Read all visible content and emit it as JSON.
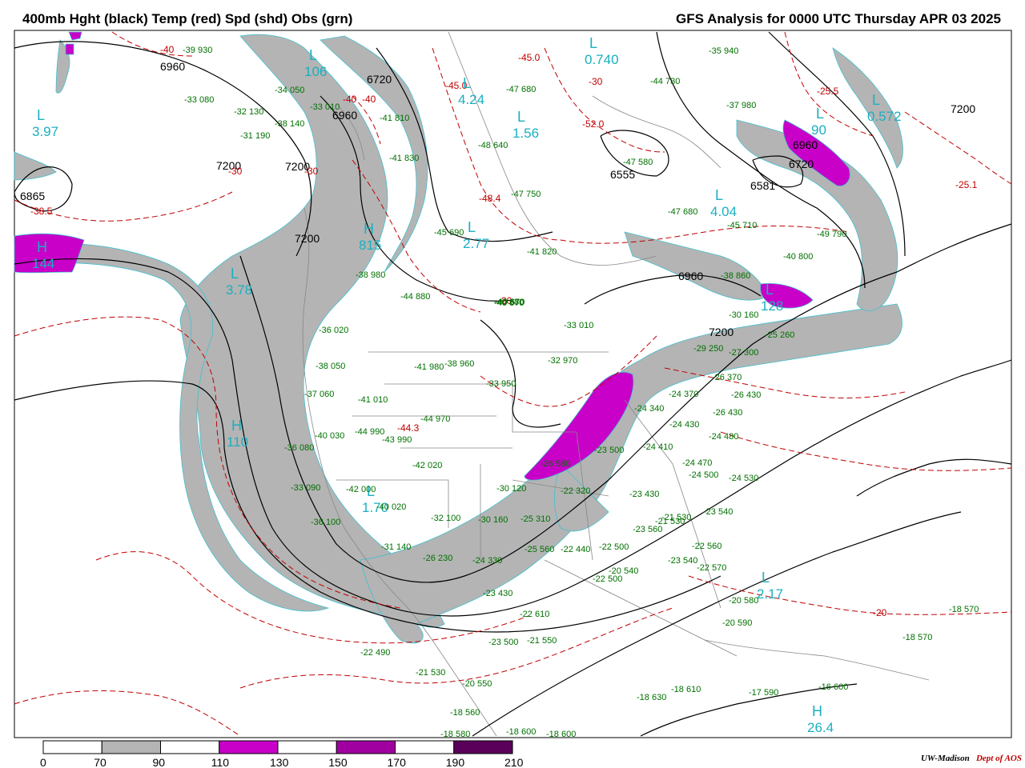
{
  "header": {
    "title_left": "400mb Hght (black) Temp (red) Spd (shd) Obs (grn)",
    "title_right": "GFS Analysis for 0000 UTC Thursday  APR 03 2025"
  },
  "colors": {
    "height": "#000000",
    "temp": "#c00000",
    "obs": "#007000",
    "center": "#1ab0c0",
    "speed_70_90": "#b4b4b4",
    "speed_110_130": "#c800c8",
    "speed_130_150": "#a000a0",
    "speed_150_170": "#7a007a",
    "speed_170_190": "#5a005a"
  },
  "height_labels": [
    "6960",
    "6720",
    "6960",
    "7200",
    "7200",
    "6865",
    "7200",
    "6555",
    "6581",
    "6960",
    "7200",
    "6960",
    "6720",
    "7200"
  ],
  "temp_labels": [
    "-40",
    "-45.0",
    "-40",
    "-30",
    "-38.5",
    "-30",
    "-45.0",
    "-48.4",
    "-52.0",
    "-25.5",
    "-25.1",
    "-30",
    "-40",
    "-20",
    "-44.3",
    "-30"
  ],
  "centers": [
    {
      "letter": "L",
      "value": "3.97"
    },
    {
      "letter": "L",
      "value": "106"
    },
    {
      "letter": "L",
      "value": "4.24"
    },
    {
      "letter": "L",
      "value": "0.740"
    },
    {
      "letter": "L",
      "value": "1.56"
    },
    {
      "letter": "L",
      "value": "0.572"
    },
    {
      "letter": "H",
      "value": "144"
    },
    {
      "letter": "L",
      "value": "3.78"
    },
    {
      "letter": "H",
      "value": "815"
    },
    {
      "letter": "L",
      "value": "2.77"
    },
    {
      "letter": "L",
      "value": "4.04"
    },
    {
      "letter": "H",
      "value": "110"
    },
    {
      "letter": "L",
      "value": "1.70"
    },
    {
      "letter": "L",
      "value": "2.17"
    },
    {
      "letter": "H",
      "value": "26.4"
    },
    {
      "letter": "L",
      "value": "90"
    },
    {
      "letter": "L",
      "value": "128"
    }
  ],
  "obs_labels": [
    "-39 930",
    "-33 080",
    "-32 130",
    "-34 050",
    "-33 010",
    "-38 140",
    "-31 190",
    "-41 810",
    "-41 830",
    "-47 680",
    "-48 640",
    "-47 750",
    "-47 580",
    "-47 680",
    "-45 710",
    "-49 790",
    "-40 800",
    "-38 860",
    "-45 690",
    "-40 680",
    "-41 820",
    "-44 880",
    "-40 870",
    "-38 980",
    "-33 010",
    "-32 970",
    "-33 950",
    "-41 980",
    "-38 960",
    "-41 010",
    "-44 970",
    "-36 020",
    "-38 050",
    "-37 060",
    "-40 030",
    "-44 990",
    "-43 990",
    "-36 080",
    "-42 020",
    "-33 090",
    "-42 000",
    "-40 020",
    "-36 100",
    "-32 100",
    "-30 160",
    "-30 120",
    "-25 310",
    "-22 320",
    "-31 140",
    "-26 230",
    "-24 330",
    "-23 430",
    "-25 560",
    "-22 440",
    "-22 500",
    "-22 500",
    "-20 540",
    "-22 610",
    "-23 500",
    "-21 550",
    "-22 490",
    "-21 530",
    "-20 550",
    "-18 560",
    "-18 580",
    "-18 600",
    "-18 600",
    "-18 630",
    "-18 610",
    "-17 590",
    "-16 600",
    "-18 570",
    "-18 570",
    "-22 560",
    "-22 570",
    "-20 580",
    "-20 590",
    "-24 340",
    "-24 370",
    "-24 410",
    "-24 430",
    "-24 470",
    "-24 480",
    "-24 500",
    "-24 530",
    "-23 540",
    "-23 560",
    "-21 530",
    "-26 370",
    "-26 430",
    "-26 430",
    "-29 250",
    "-27 300",
    "-25 260",
    "-30 160",
    "-35 940",
    "-37 980",
    "-44 730",
    "-40 670",
    "-26 580",
    "-23 430",
    "-23 540",
    "-21 530",
    "-23 500"
  ],
  "legend": {
    "ticks": [
      "0",
      "70",
      "90",
      "110",
      "130",
      "150",
      "170",
      "190",
      "210"
    ]
  },
  "credit": {
    "org": "UW-Madison",
    "dept": "Dept of AOS"
  }
}
